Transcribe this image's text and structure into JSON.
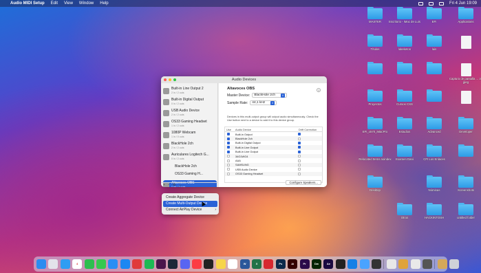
{
  "menubar": {
    "apple": "",
    "app": "Audio MIDI Setup",
    "menus": [
      "Edit",
      "View",
      "Window",
      "Help"
    ],
    "clock": "Fri 4 Jun  19:09"
  },
  "desktop_icons": [
    {
      "label": "MASTER",
      "type": "folder"
    },
    {
      "label": "Escritorio - iMac de Luis",
      "type": "folder"
    },
    {
      "label": "EFI",
      "type": "folder"
    },
    {
      "label": "Applications",
      "type": "folder"
    },
    {
      "label": "Títulos",
      "type": "folder"
    },
    {
      "label": "lukeketon",
      "type": "folder"
    },
    {
      "label": "luis",
      "type": "folder"
    },
    {
      "label": "",
      "type": "doc"
    },
    {
      "label": "",
      "type": "folder"
    },
    {
      "label": "",
      "type": "folder"
    },
    {
      "label": "",
      "type": "folder"
    },
    {
      "label": "Captura de pantalla ... 38 jpeg",
      "type": "doc"
    },
    {
      "label": "Proyectos",
      "type": "folder"
    },
    {
      "label": "Cursos CSS",
      "type": "folder"
    },
    {
      "label": "",
      "type": "folder"
    },
    {
      "label": "",
      "type": "doc"
    },
    {
      "label": "EFI_x570_iMacPro",
      "type": "folder"
    },
    {
      "label": "Estudios",
      "type": "folder"
    },
    {
      "label": "Advanced",
      "type": "folder"
    },
    {
      "label": "Developer",
      "type": "folder"
    },
    {
      "label": "Relocated Items.noindex",
      "type": "folder"
    },
    {
      "label": "Examen Dani",
      "type": "folder"
    },
    {
      "label": "CFI Los Enlaces",
      "type": "folder"
    },
    {
      "label": "",
      "type": "folder"
    },
    {
      "label": "Desktop",
      "type": "folder"
    },
    {
      "label": "Nóminas",
      "type": "folder"
    },
    {
      "label": "Screenshots",
      "type": "folder"
    },
    {
      "label": "Otros",
      "type": "folder"
    },
    {
      "label": "HACKINTOSH",
      "type": "folder"
    },
    {
      "label": "untitled folder",
      "type": "folder"
    }
  ],
  "window": {
    "title": "Audio Devices"
  },
  "sidebar": {
    "devices": [
      {
        "name": "Built-in Line Output 2",
        "sub": "2 in / 2 outs",
        "indent": false
      },
      {
        "name": "Built-in Digital Output",
        "sub": "0 in / 2 outs",
        "indent": false
      },
      {
        "name": "USB Audio Device",
        "sub": "2 in / 2 outs",
        "indent": false
      },
      {
        "name": "OS33 Gaming Headset",
        "sub": "1 in / 2 outs",
        "indent": false
      },
      {
        "name": "1080P Webcam",
        "sub": "1 in / 0 outs",
        "indent": false
      },
      {
        "name": "BlackHole 2ch",
        "sub": "2 in / 2 outs",
        "indent": false
      },
      {
        "name": "Auriculares Logitech G...",
        "sub": "0 in / 2 outs",
        "indent": false
      },
      {
        "name": "BlackHole 2ch",
        "sub": "",
        "indent": true
      },
      {
        "name": "OS33 Gaming H...",
        "sub": "",
        "indent": true
      },
      {
        "name": "Altavoces OBS",
        "sub": "0 ins / 2 outs",
        "indent": false,
        "selected": true
      }
    ],
    "footer": {
      "add": "+",
      "remove": "−",
      "gear": "⚙",
      "chev": "⌄"
    }
  },
  "main": {
    "title": "Altavoces OBS",
    "help": "?",
    "master_label": "Master Device:",
    "master_value": "BlackHole 2ch",
    "rate_label": "Sample Rate:",
    "rate_value": "44,1 kHz",
    "description": "Devices in this multi-output group will output audio simultaneously. Check the Use button next to a device to add it to this device group.",
    "columns": {
      "use": "Use",
      "device": "Audio Device",
      "drift": "Drift Correction"
    },
    "rows": [
      {
        "name": "Built-in Output",
        "use": true,
        "drift": true
      },
      {
        "name": "BlackHole 2ch",
        "use": true,
        "drift": false
      },
      {
        "name": "Built-in Digital Output",
        "use": true,
        "drift": true
      },
      {
        "name": "Built-in Line Output",
        "use": true,
        "drift": true
      },
      {
        "name": "Built-in Line Output",
        "use": true,
        "drift": true
      },
      {
        "name": "34G1WG4",
        "use": false,
        "drift": false
      },
      {
        "name": "AAA",
        "use": false,
        "drift": false
      },
      {
        "name": "SAMSUNG",
        "use": false,
        "drift": false
      },
      {
        "name": "USB Audio Device",
        "use": false,
        "drift": false
      },
      {
        "name": "OS33 Gaming Headset",
        "use": false,
        "drift": false
      }
    ],
    "configure_button": "Configure Speakers..."
  },
  "context_menu": {
    "items": [
      {
        "label": "Create Aggregate Device",
        "highlighted": false,
        "submenu": false
      },
      {
        "label": "Create Multi-Output Device",
        "highlighted": true,
        "submenu": false
      },
      {
        "label": "Connect AirPlay Device",
        "highlighted": false,
        "submenu": true
      }
    ]
  },
  "dock": {
    "apps": [
      {
        "name": "Finder",
        "color": "#2b8cf0",
        "text": ""
      },
      {
        "name": "Launchpad",
        "color": "#e3e3ea",
        "text": ""
      },
      {
        "name": "Safari",
        "color": "#2f9df2",
        "text": ""
      },
      {
        "name": "Calendar",
        "color": "#ffffff",
        "text": "4"
      },
      {
        "name": "FaceTime",
        "color": "#2dbe4f",
        "text": ""
      },
      {
        "name": "Messages",
        "color": "#35c94e",
        "text": ""
      },
      {
        "name": "Mail",
        "color": "#2a8ef4",
        "text": ""
      },
      {
        "name": "App Store",
        "color": "#1b87f2",
        "text": ""
      },
      {
        "name": "Prefs",
        "color": "#e03a3a",
        "text": ""
      },
      {
        "name": "Spotify",
        "color": "#1db954",
        "text": ""
      },
      {
        "name": "Slack",
        "color": "#4a154b",
        "text": ""
      },
      {
        "name": "Steam",
        "color": "#1b2838",
        "text": ""
      },
      {
        "name": "Discord",
        "color": "#5865f2",
        "text": ""
      },
      {
        "name": "Music",
        "color": "#fc3c44",
        "text": ""
      },
      {
        "name": "OBS",
        "color": "#222",
        "text": ""
      },
      {
        "name": "Notes",
        "color": "#f7d54a",
        "text": ""
      },
      {
        "name": "Photos",
        "color": "#ffffff",
        "text": ""
      },
      {
        "name": "Word",
        "color": "#2b579a",
        "text": "W"
      },
      {
        "name": "Excel",
        "color": "#217346",
        "text": "X"
      },
      {
        "name": "Acrobat",
        "color": "#d7282f",
        "text": ""
      },
      {
        "name": "Photoshop",
        "color": "#0d2a4a",
        "text": "Ps"
      },
      {
        "name": "Illustrator",
        "color": "#330000",
        "text": "Ai"
      },
      {
        "name": "Premiere",
        "color": "#2a0a4a",
        "text": "Pr"
      },
      {
        "name": "Dreamweaver",
        "color": "#072401",
        "text": "Dw"
      },
      {
        "name": "After Effects",
        "color": "#1a0a40",
        "text": "Ae"
      },
      {
        "name": "Unity",
        "color": "#222",
        "text": ""
      },
      {
        "name": "Xcode",
        "color": "#1580e6",
        "text": ""
      },
      {
        "name": "Maps",
        "color": "#4aa3ff",
        "text": ""
      },
      {
        "name": "Activity",
        "color": "#333",
        "text": ""
      },
      {
        "name": "Audio",
        "color": "#e8e8e8",
        "text": ""
      },
      {
        "name": "Keychain",
        "color": "#e0a33a",
        "text": ""
      },
      {
        "name": "Preview",
        "color": "#e9e9e9",
        "text": ""
      },
      {
        "name": "Finder2",
        "color": "#555",
        "text": ""
      },
      {
        "name": "Downloads",
        "color": "#d5a85a",
        "text": ""
      },
      {
        "name": "Trash",
        "color": "#cfd2d8",
        "text": ""
      }
    ]
  }
}
